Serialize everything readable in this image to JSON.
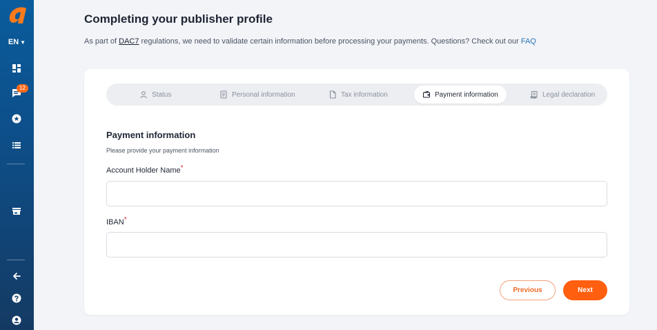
{
  "sidebar": {
    "language": "EN",
    "items": [
      {
        "icon": "dashboard-icon"
      },
      {
        "icon": "messages-icon",
        "badge": "12"
      },
      {
        "icon": "star-icon"
      },
      {
        "icon": "list-icon"
      },
      {
        "icon": "store-icon"
      },
      {
        "icon": "arrow-left-icon"
      },
      {
        "icon": "help-icon"
      },
      {
        "icon": "user-icon"
      }
    ]
  },
  "header": {
    "title": "Completing your publisher profile",
    "intro_before": "As part of ",
    "intro_link": "DAC7",
    "intro_after": " regulations, we need to validate certain information before processing your payments. Questions? Check out our ",
    "faq_link": "FAQ"
  },
  "stepper": {
    "steps": [
      {
        "label": "Status",
        "icon": "user-icon"
      },
      {
        "label": "Personal information",
        "icon": "document-icon"
      },
      {
        "label": "Tax information",
        "icon": "file-icon"
      },
      {
        "label": "Payment information",
        "icon": "wallet-icon",
        "active": true
      },
      {
        "label": "Legal declaration",
        "icon": "scroll-icon"
      }
    ]
  },
  "form": {
    "title": "Payment information",
    "subtitle": "Please provide your payment information",
    "account_holder_label": "Account Holder Name",
    "account_holder_value": "",
    "iban_label": "IBAN",
    "iban_value": "",
    "required_mark": "*"
  },
  "buttons": {
    "previous": "Previous",
    "next": "Next"
  },
  "colors": {
    "accent": "#ff5f0f",
    "sidebar_top": "#0a5c9c",
    "sidebar_bottom": "#143a63",
    "link": "#2a72b5",
    "required": "#e0242e"
  }
}
